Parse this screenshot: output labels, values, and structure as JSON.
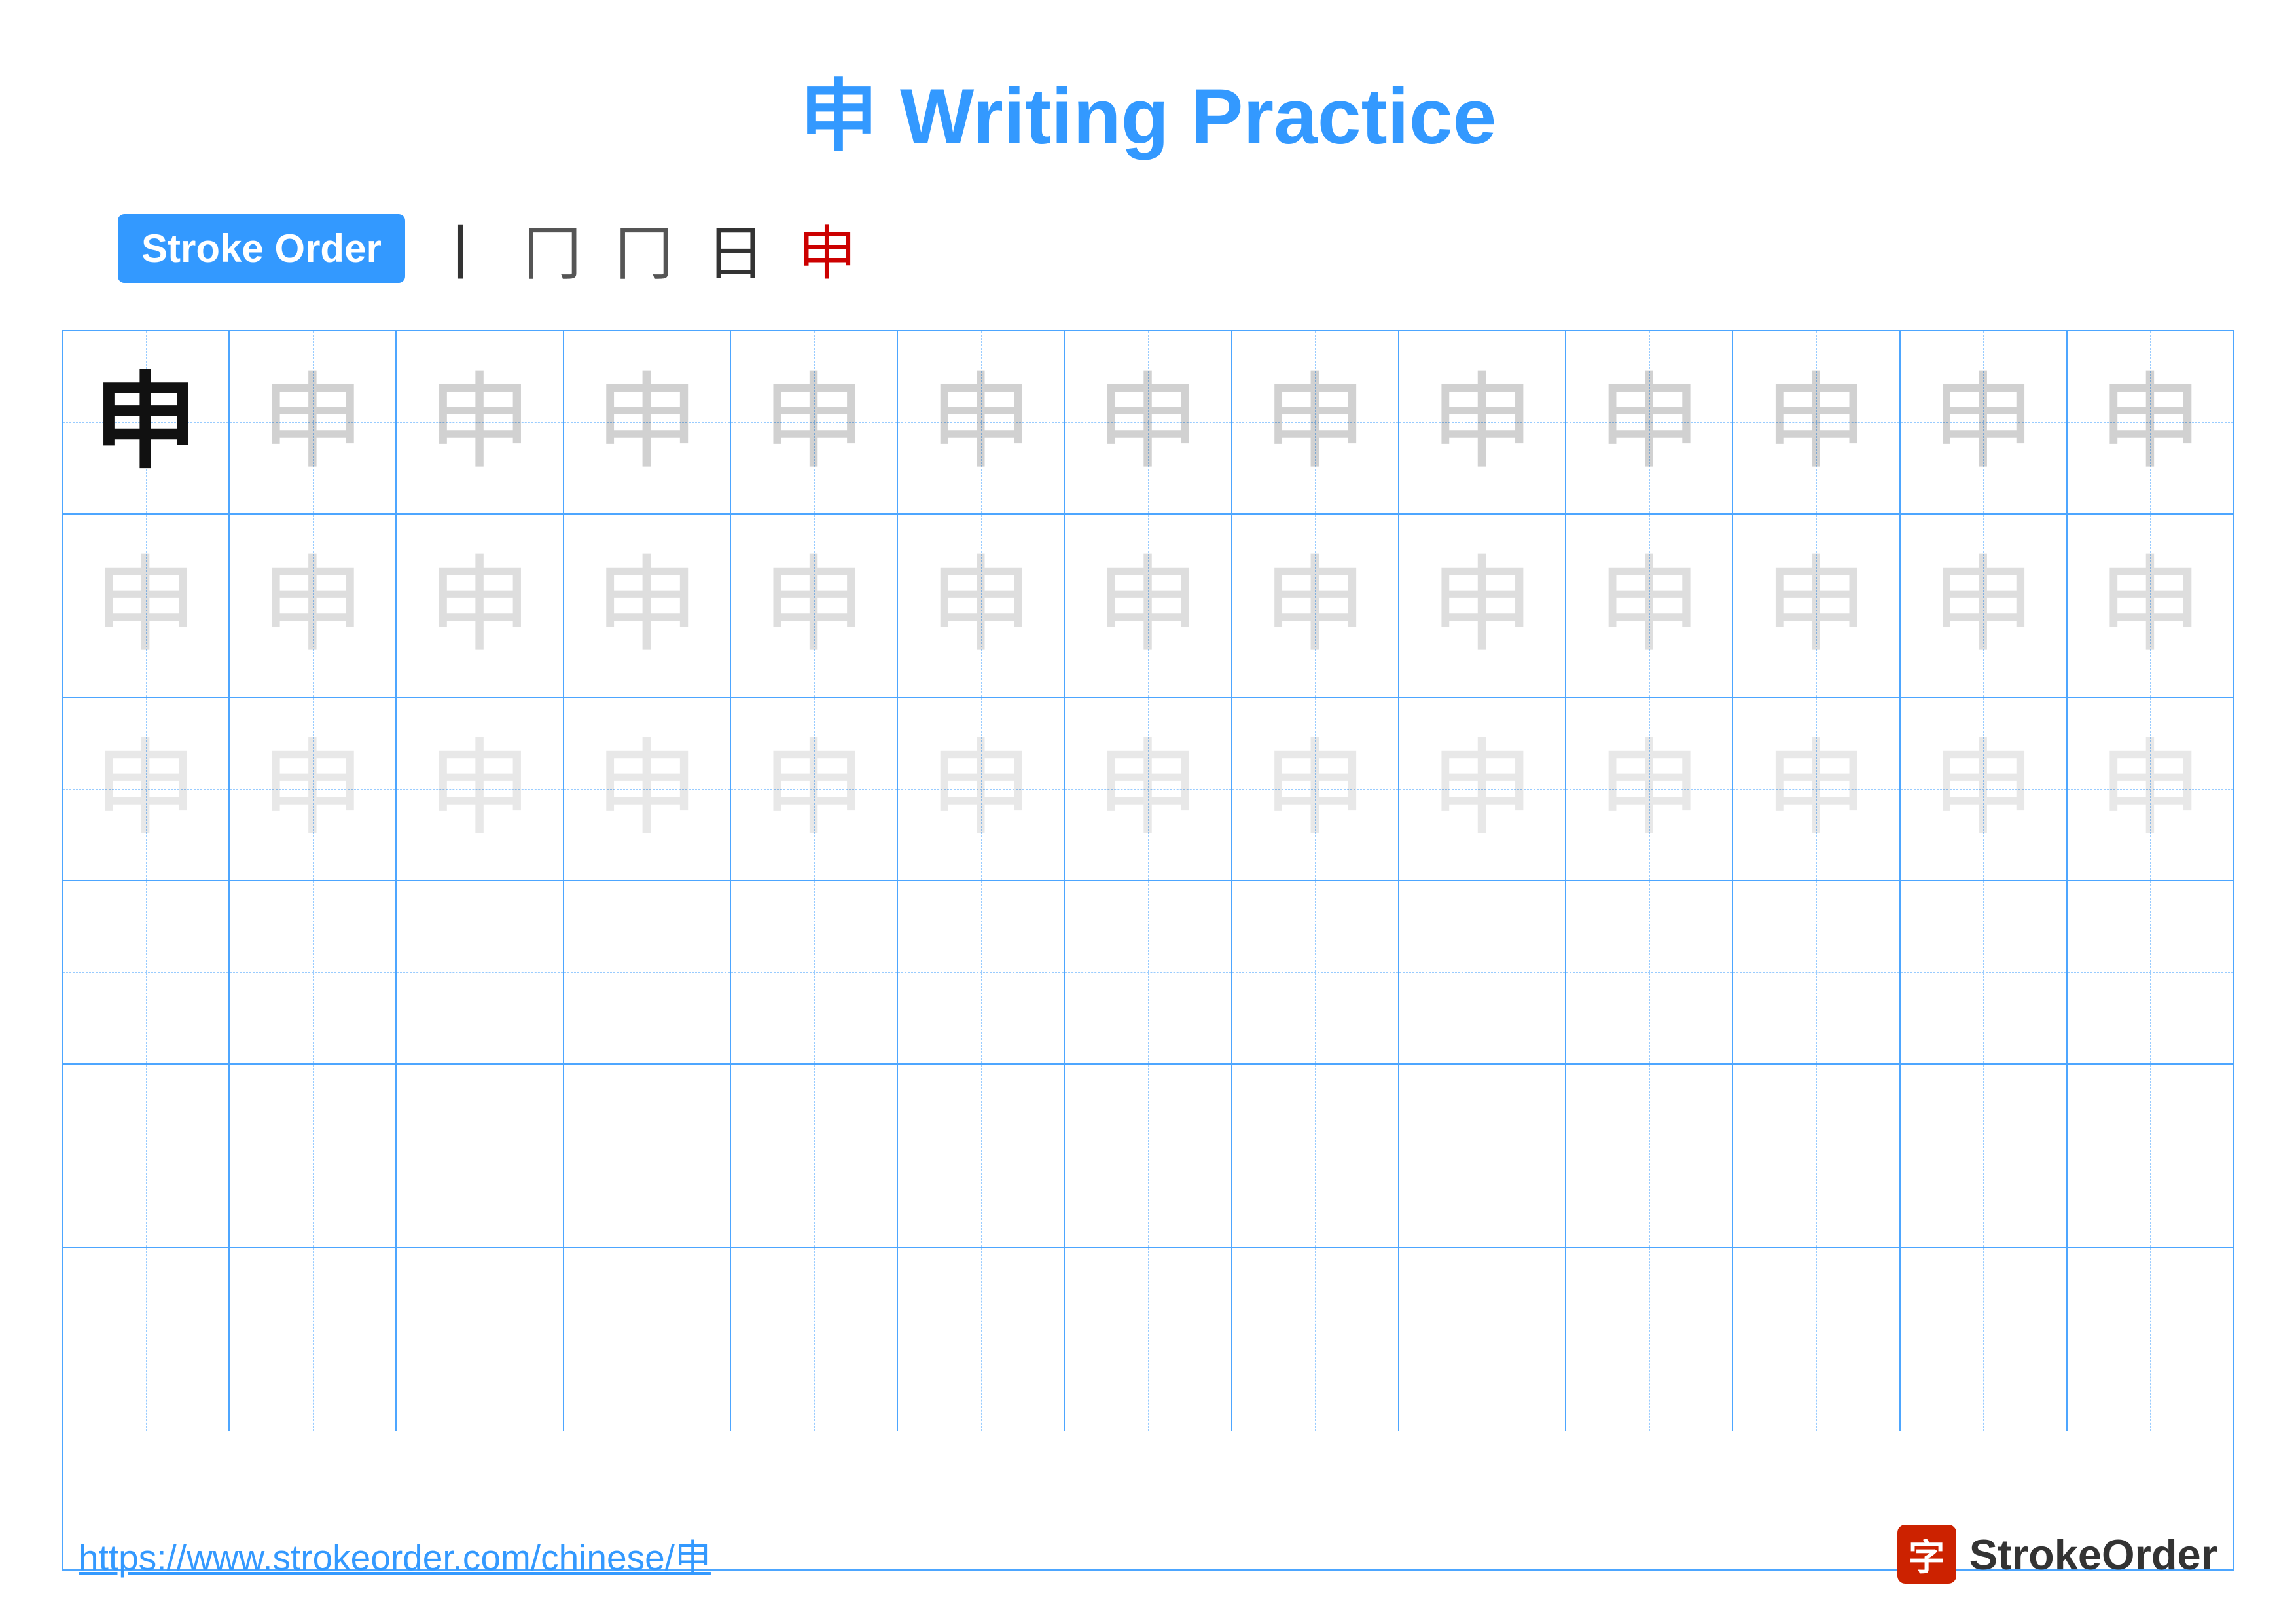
{
  "title": {
    "char": "申",
    "text": "Writing Practice",
    "full": "申 Writing Practice"
  },
  "stroke_order": {
    "badge_label": "Stroke Order",
    "steps": [
      "丨",
      "冂",
      "冂",
      "日",
      "申"
    ]
  },
  "grid": {
    "rows": 6,
    "cols": 13,
    "char": "申",
    "row_types": [
      "solid_then_dark",
      "medium",
      "light",
      "empty",
      "empty",
      "empty"
    ]
  },
  "footer": {
    "url": "https://www.strokeorder.com/chinese/申",
    "logo_text": "StrokeOrder",
    "logo_char": "字"
  }
}
